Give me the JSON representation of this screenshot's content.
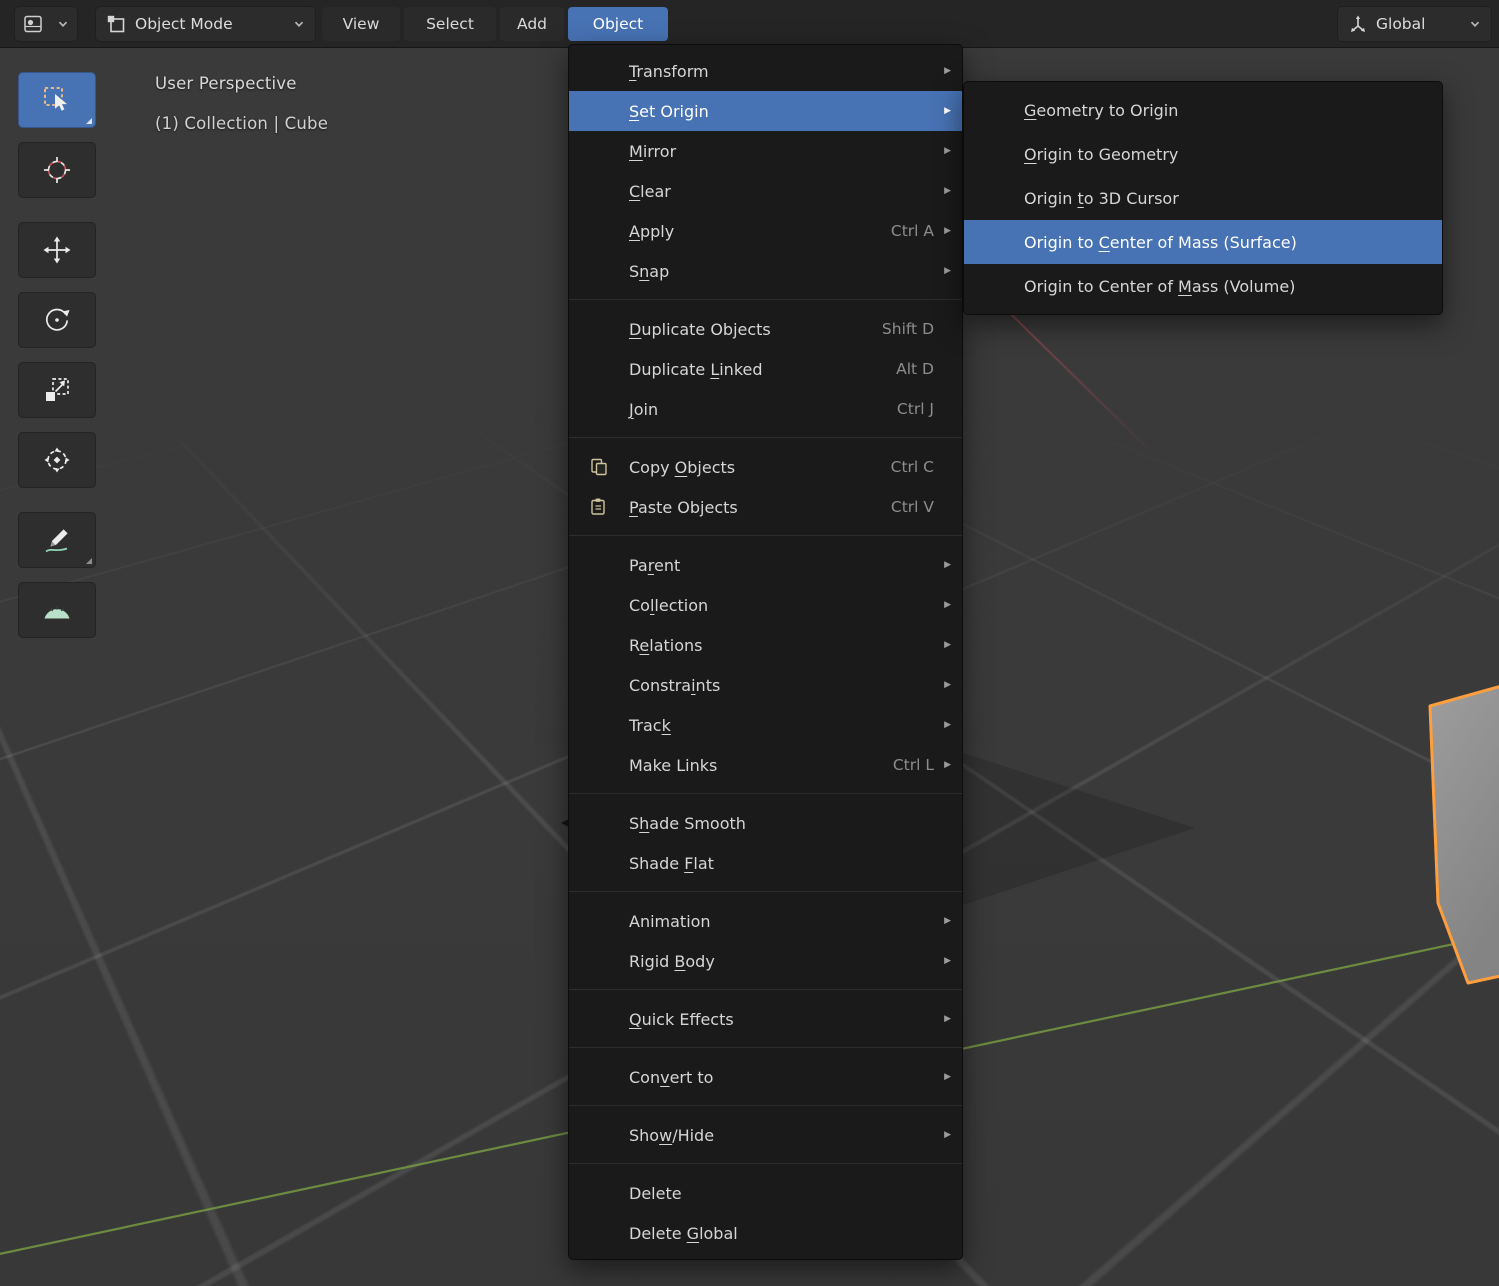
{
  "header": {
    "editor_selector": {
      "name": "3d-viewport"
    },
    "mode_selector": {
      "label": "Object Mode"
    },
    "menus": [
      {
        "id": "view",
        "label": "View"
      },
      {
        "id": "select",
        "label": "Select"
      },
      {
        "id": "add",
        "label": "Add"
      },
      {
        "id": "object",
        "label": "Object",
        "active": true
      }
    ],
    "orientation": {
      "label": "Global"
    }
  },
  "viewport_overlay": {
    "view_label": "User Perspective",
    "context_label": "(1) Collection | Cube"
  },
  "toolbar": {
    "tools": [
      {
        "name": "select-box",
        "icon": "select-box-icon",
        "active": true,
        "has_options": true
      },
      {
        "name": "cursor",
        "icon": "cursor-icon"
      },
      {
        "name": "move",
        "icon": "move-icon",
        "gap_before": true
      },
      {
        "name": "rotate",
        "icon": "rotate-icon"
      },
      {
        "name": "scale",
        "icon": "scale-icon"
      },
      {
        "name": "transform",
        "icon": "transform-icon"
      },
      {
        "name": "annotate",
        "icon": "annotate-icon",
        "gap_before": true,
        "has_options": true
      },
      {
        "name": "measure",
        "icon": "measure-icon"
      }
    ]
  },
  "object_menu": {
    "items": [
      {
        "label": "Transform",
        "u": 0,
        "submenu": true
      },
      {
        "label": "Set Origin",
        "u": 0,
        "submenu": true,
        "highlighted": true
      },
      {
        "label": "Mirror",
        "u": 0,
        "submenu": true
      },
      {
        "label": "Clear",
        "u": 0,
        "submenu": true
      },
      {
        "label": "Apply",
        "u": 0,
        "submenu": true,
        "shortcut": "Ctrl A"
      },
      {
        "label": "Snap",
        "u": 1,
        "submenu": true
      },
      {
        "separator": true
      },
      {
        "label": "Duplicate Objects",
        "u": 0,
        "shortcut": "Shift D"
      },
      {
        "label": "Duplicate Linked",
        "u": 10,
        "shortcut": "Alt D"
      },
      {
        "label": "Join",
        "u": 0,
        "shortcut": "Ctrl J"
      },
      {
        "separator": true
      },
      {
        "label": "Copy Objects",
        "u": 5,
        "shortcut": "Ctrl C",
        "icon": "copy-icon"
      },
      {
        "label": "Paste Objects",
        "u": 0,
        "shortcut": "Ctrl V",
        "icon": "paste-icon"
      },
      {
        "separator": true
      },
      {
        "label": "Parent",
        "u": 2,
        "submenu": true
      },
      {
        "label": "Collection",
        "u": 2,
        "submenu": true
      },
      {
        "label": "Relations",
        "u": 1,
        "submenu": true
      },
      {
        "label": "Constraints",
        "u": 7,
        "submenu": true
      },
      {
        "label": "Track",
        "u": 4,
        "submenu": true
      },
      {
        "label": "Make Links",
        "shortcut": "Ctrl L",
        "submenu": true
      },
      {
        "separator": true
      },
      {
        "label": "Shade Smooth",
        "u": 1
      },
      {
        "label": "Shade Flat",
        "u": 6
      },
      {
        "separator": true
      },
      {
        "label": "Animation",
        "submenu": true
      },
      {
        "label": "Rigid Body",
        "u": 6,
        "submenu": true
      },
      {
        "separator": true
      },
      {
        "label": "Quick Effects",
        "u": 0,
        "submenu": true
      },
      {
        "separator": true
      },
      {
        "label": "Convert to",
        "u": 3,
        "submenu": true
      },
      {
        "separator": true
      },
      {
        "label": "Show/Hide",
        "u": 3,
        "submenu": true
      },
      {
        "separator": true
      },
      {
        "label": "Delete"
      },
      {
        "label": "Delete Global",
        "u": 7
      }
    ]
  },
  "set_origin_submenu": {
    "items": [
      {
        "label": "Geometry to Origin",
        "u": 0
      },
      {
        "label": "Origin to Geometry",
        "u": 0
      },
      {
        "label": "Origin to 3D Cursor",
        "u": 7
      },
      {
        "label": "Origin to Center of Mass (Surface)",
        "u": 10,
        "highlighted": true
      },
      {
        "label": "Origin to Center of Mass (Volume)",
        "u": 20
      }
    ]
  },
  "colors": {
    "accent": "#4772b3",
    "selection_outline": "#ff9e3d",
    "axis_x": "#c94f5c",
    "axis_y": "#7ba042",
    "menu_bg": "#1a1a1a",
    "viewport_bg": "#3a3a3a"
  }
}
